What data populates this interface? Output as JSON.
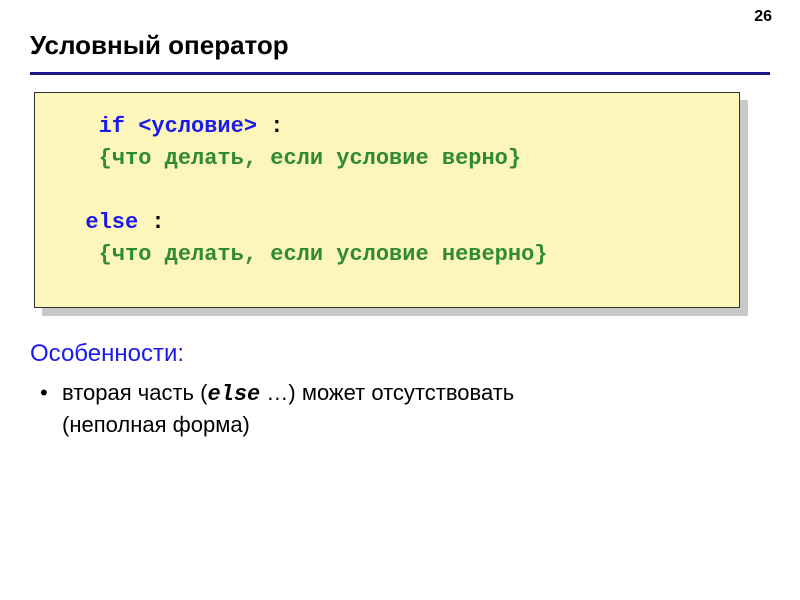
{
  "page_number": "26",
  "title": "Условный оператор",
  "code": {
    "l1_indent": "   ",
    "l1_if": "if",
    "l1_space": " ",
    "l1_cond": "<условие>",
    "l1_tail": " :",
    "l2_indent": "   ",
    "l2_body": "{что делать, если условие верно}",
    "blank": "",
    "l3_indent": "  ",
    "l3_else": "else",
    "l3_tail": " :",
    "l4_indent": "   ",
    "l4_body": "{что делать, если условие неверно}"
  },
  "features": {
    "heading": "Особенности:",
    "bullet_prefix": "вторая часть (",
    "bullet_else": "else",
    "bullet_mid": " …) может отсутствовать",
    "bullet_line2": "(неполная форма)"
  }
}
